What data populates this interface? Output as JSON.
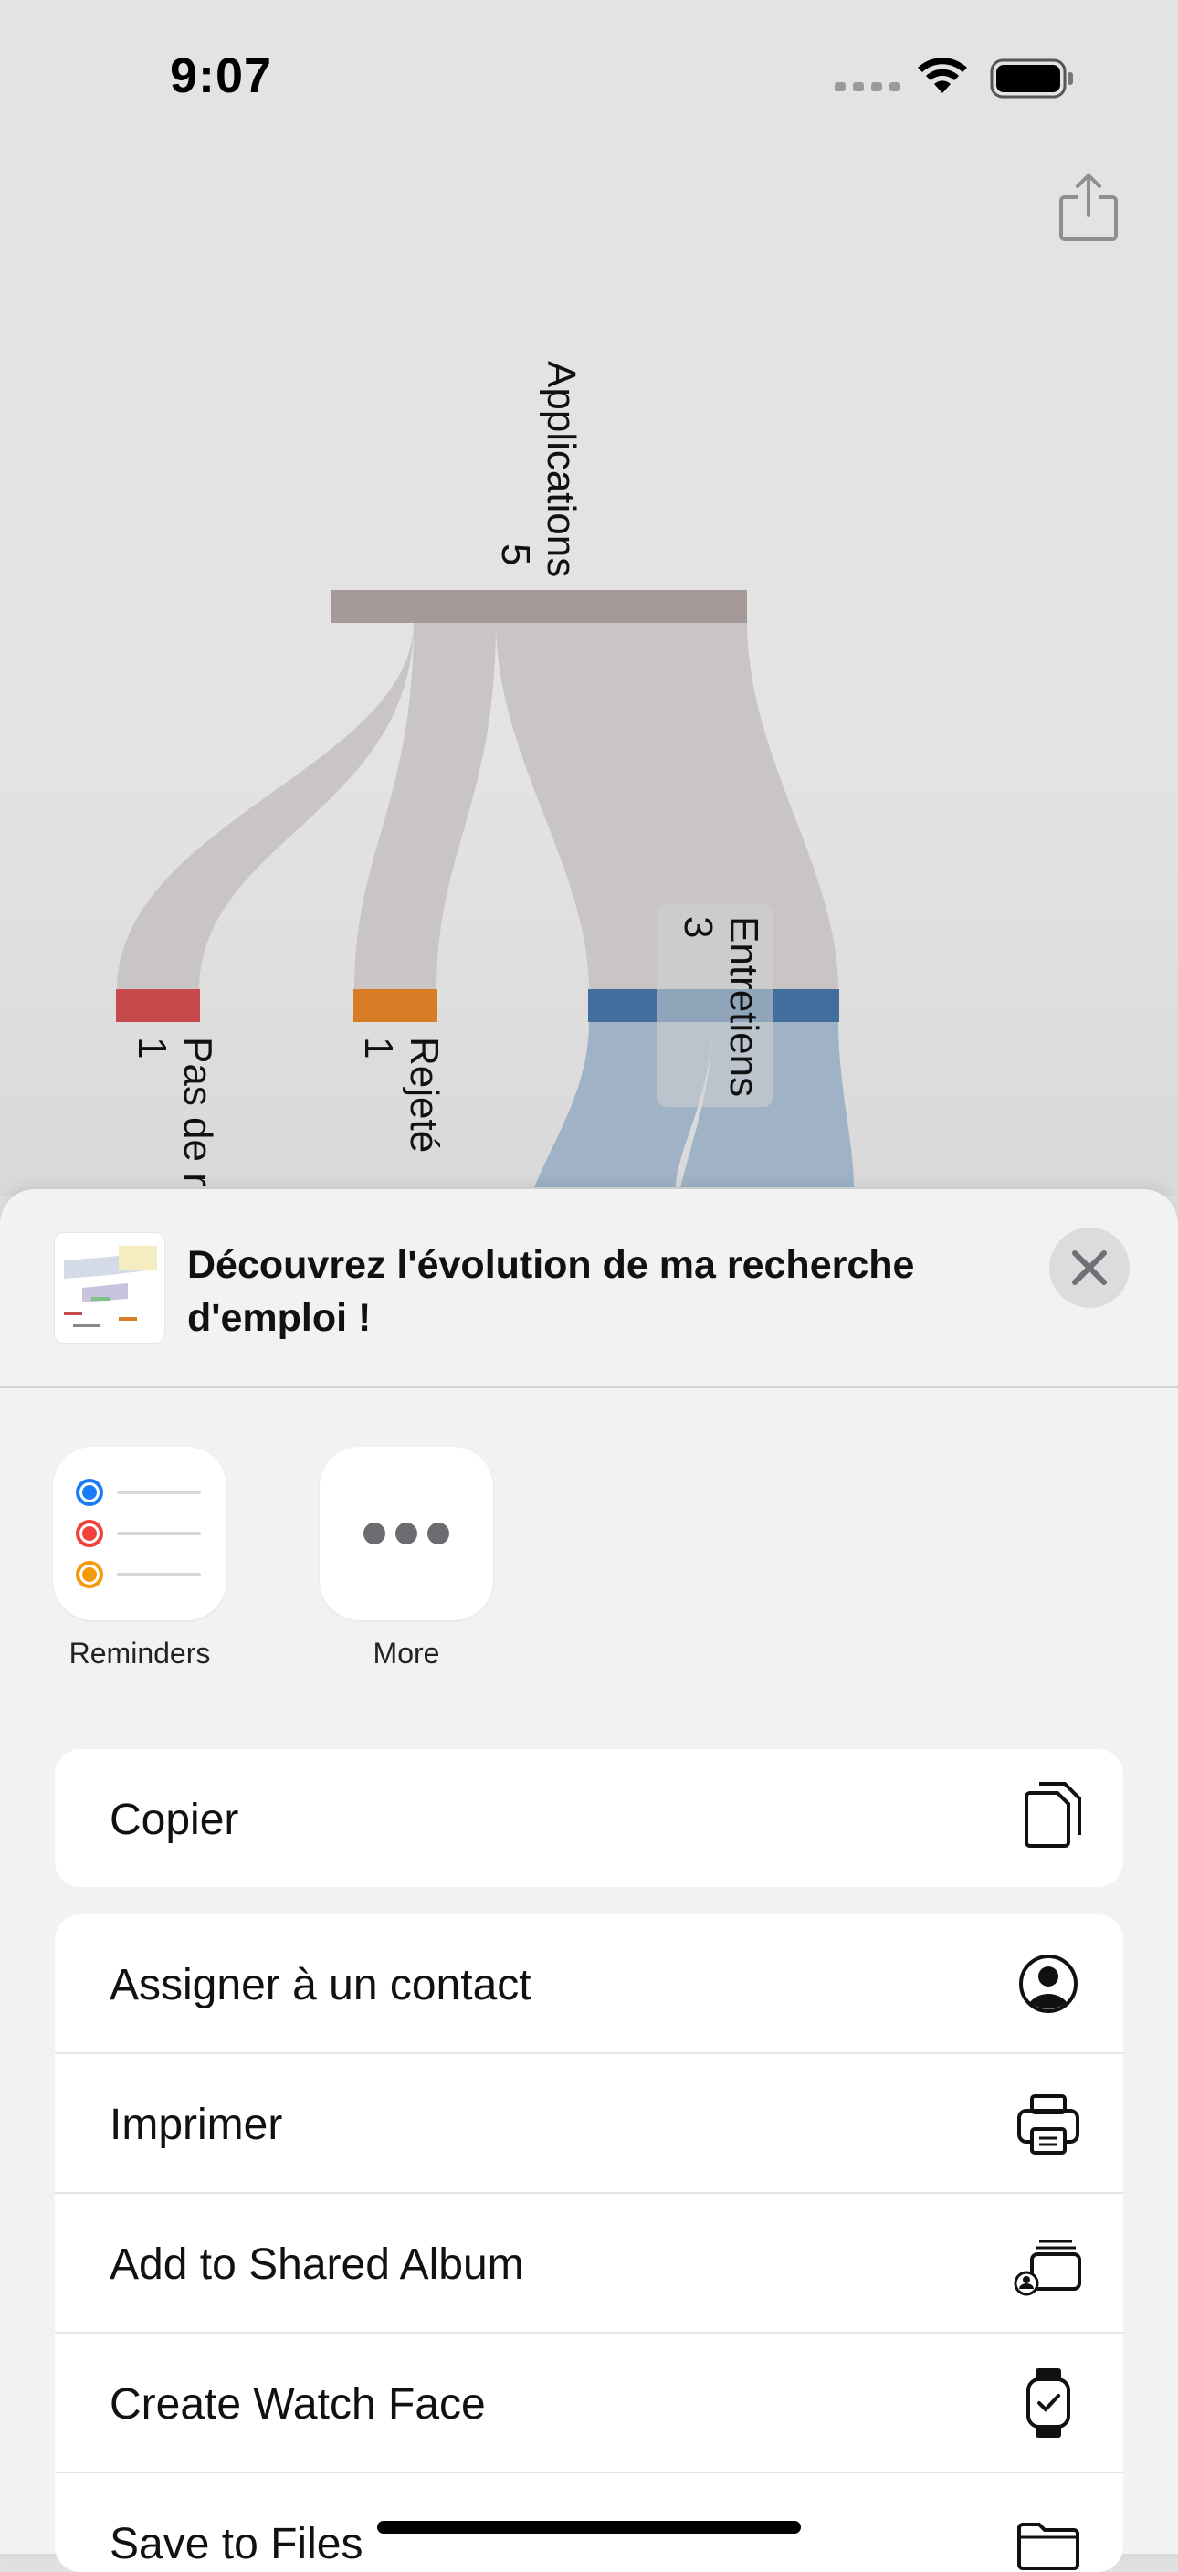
{
  "status_bar": {
    "time": "9:07"
  },
  "chart_data": {
    "type": "sankey",
    "nodes": [
      {
        "name": "Applications",
        "value": 5,
        "color": "#a59a99"
      },
      {
        "name": "Pas de r",
        "value": 1,
        "color": "#c64a4c"
      },
      {
        "name": "Rejeté",
        "value": 1,
        "color": "#d97c26"
      },
      {
        "name": "Entretiens",
        "value": 3,
        "color": "#416e9c"
      }
    ],
    "links": [
      {
        "source": "Applications",
        "target": "Pas de r",
        "value": 1
      },
      {
        "source": "Applications",
        "target": "Rejeté",
        "value": 1
      },
      {
        "source": "Applications",
        "target": "Entretiens",
        "value": 3
      }
    ],
    "labels": {
      "applications": "Applications",
      "applications_value": "5",
      "pas_de_reponse": "Pas de r",
      "pas_de_reponse_value": "1",
      "rejete": "Rejeté",
      "rejete_value": "1",
      "entretiens": "Entretiens",
      "entretiens_value": "3"
    }
  },
  "share_sheet": {
    "title": "Découvrez l'évolution de ma recherche d'emploi !",
    "apps": [
      {
        "label": "Reminders",
        "icon": "reminders-icon"
      },
      {
        "label": "More",
        "icon": "more-icon"
      }
    ],
    "actions_group1": [
      {
        "label": "Copier",
        "icon": "copy-icon"
      }
    ],
    "actions_group2": [
      {
        "label": "Assigner à un contact",
        "icon": "person-circle-icon"
      },
      {
        "label": "Imprimer",
        "icon": "printer-icon"
      },
      {
        "label": "Add to Shared Album",
        "icon": "shared-album-icon"
      },
      {
        "label": "Create Watch Face",
        "icon": "watch-icon"
      },
      {
        "label": "Save to Files",
        "icon": "folder-icon"
      }
    ]
  }
}
